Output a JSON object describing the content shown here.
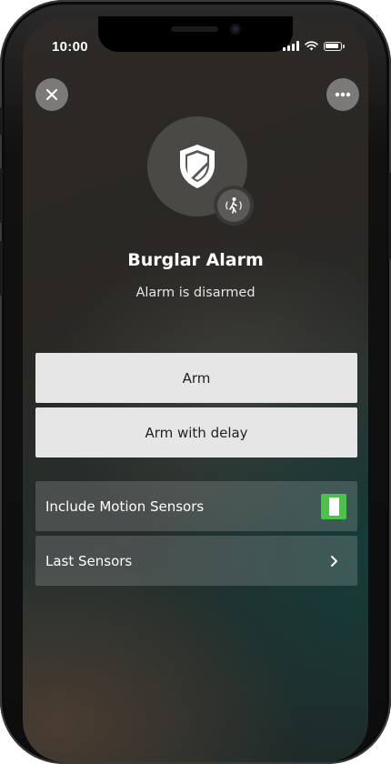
{
  "status_bar": {
    "time": "10:00",
    "icons": [
      "cellular-signal-icon",
      "wifi-icon",
      "battery-icon"
    ]
  },
  "top_bar": {
    "close_icon": "close-icon",
    "more_icon": "more-options-icon"
  },
  "device": {
    "icon": "shield-icon",
    "badge_icon": "motion-sensor-icon",
    "name": "Burglar Alarm",
    "status": "Alarm is disarmed"
  },
  "actions": {
    "arm_label": "Arm",
    "arm_delay_label": "Arm with delay"
  },
  "settings": {
    "motion_sensors": {
      "label": "Include Motion Sensors",
      "enabled": true
    },
    "last_sensors": {
      "label": "Last Sensors",
      "icon": "chevron-right-icon"
    }
  },
  "colors": {
    "toggle_on": "#49c34a",
    "button_bg": "#e6e6e6"
  }
}
